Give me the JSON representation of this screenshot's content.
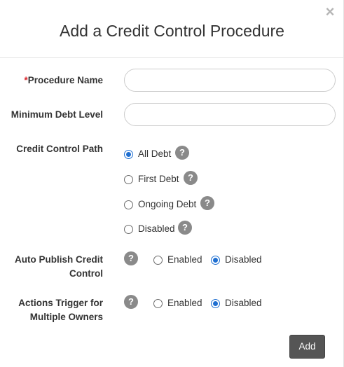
{
  "dialog": {
    "title": "Add a Credit Control Procedure",
    "close_glyph": "×"
  },
  "fields": {
    "procedure_name": {
      "required_mark": "*",
      "label": "Procedure Name",
      "value": "",
      "placeholder": ""
    },
    "minimum_debt_level": {
      "label": "Minimum Debt Level",
      "value": "",
      "placeholder": ""
    }
  },
  "credit_control_path": {
    "label": "Credit Control Path",
    "selected": "All Debt",
    "options": [
      {
        "label": "All Debt",
        "checked": true
      },
      {
        "label": "First Debt",
        "checked": false
      },
      {
        "label": "Ongoing Debt",
        "checked": false
      },
      {
        "label": "Disabled",
        "checked": false
      }
    ]
  },
  "auto_publish": {
    "label_line1": "Auto Publish Credit",
    "label_line2": "Control",
    "selected": "Disabled",
    "options": [
      {
        "label": "Enabled",
        "checked": false
      },
      {
        "label": "Disabled",
        "checked": true
      }
    ]
  },
  "actions_trigger": {
    "label_line1": "Actions Trigger for",
    "label_line2": "Multiple Owners",
    "selected": "Disabled",
    "options": [
      {
        "label": "Enabled",
        "checked": false
      },
      {
        "label": "Disabled",
        "checked": true
      }
    ]
  },
  "help_glyph": "?",
  "footer": {
    "add_label": "Add"
  },
  "colors": {
    "accent": "#1f6fd1",
    "required": "#d9262c",
    "button": "#555555",
    "help": "#8a8a8a"
  },
  "icons": {
    "close": "close-icon",
    "help": "help-icon"
  }
}
